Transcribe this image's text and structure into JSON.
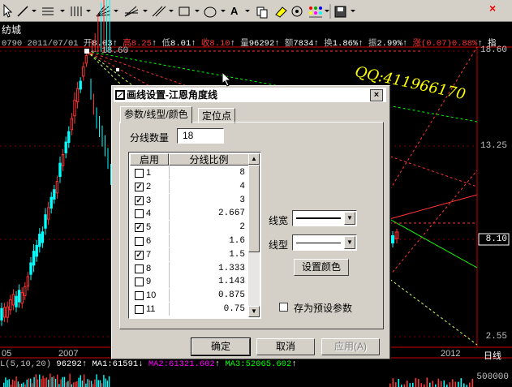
{
  "toolbar": {
    "tools": [
      "pointer-icon",
      "line-icon",
      "channel-icon",
      "parallel-icon",
      "fan-icon",
      "gann-icon",
      "ray-icon",
      "rect-icon",
      "ellipse-icon",
      "text-icon",
      "copy-icon",
      "eraser-icon",
      "eye-icon",
      "palette-icon",
      "save-icon"
    ],
    "text_tool": "A"
  },
  "stock": {
    "name": "纺城",
    "code": "0790",
    "date": "2011/07/01",
    "open_label": "开",
    "open": "8.03",
    "high_label": "高",
    "high": "8.25",
    "low_label": "低",
    "low": "8.01",
    "close_label": "收",
    "close": "8.10",
    "vol_label": "量",
    "vol": "96292",
    "amount_label": "额",
    "amount": "7834",
    "turnover_label": "换",
    "turnover": "1.86%",
    "amp_label": "振",
    "amp": "2.99%",
    "chg_label": "涨",
    "chg": "(0.07)",
    "chg_pct": "0.88%",
    "more": "指"
  },
  "chart": {
    "y_labels": [
      "18.60",
      "13.25",
      "8.10",
      "2.55"
    ],
    "peak_label": "18.60",
    "x_labels": [
      "05",
      "2007",
      "2012",
      "日线"
    ],
    "watermark": "QQ:411966170"
  },
  "indicator": {
    "name": "L(5,10,20)",
    "vol": "96292",
    "ma1": "MA1:61591",
    "ma2": "MA2:61321.602",
    "ma3": "MA3:52065.602",
    "vol_axis": "500000"
  },
  "dialog": {
    "title": "画线设置-江恩角度线",
    "close": "×",
    "tabs": [
      "参数/线型/颜色",
      "定位点"
    ],
    "split_count_label": "分线数量",
    "split_count": "18",
    "col_enable": "启用",
    "col_ratio": "分线比例",
    "rows": [
      {
        "n": "1",
        "checked": false,
        "v": "8"
      },
      {
        "n": "2",
        "checked": true,
        "v": "4"
      },
      {
        "n": "3",
        "checked": true,
        "v": "3"
      },
      {
        "n": "4",
        "checked": false,
        "v": "2.667"
      },
      {
        "n": "5",
        "checked": true,
        "v": "2"
      },
      {
        "n": "6",
        "checked": false,
        "v": "1.6"
      },
      {
        "n": "7",
        "checked": true,
        "v": "1.5"
      },
      {
        "n": "8",
        "checked": false,
        "v": "1.333"
      },
      {
        "n": "9",
        "checked": false,
        "v": "1.143"
      },
      {
        "n": "10",
        "checked": false,
        "v": "0.875"
      },
      {
        "n": "11",
        "checked": false,
        "v": "0.75"
      }
    ],
    "line_width_label": "线宽",
    "line_type_label": "线型",
    "set_color": "设置颜色",
    "save_preset": "存为预设参数",
    "ok": "确定",
    "cancel": "取消",
    "apply": "应用(A)"
  },
  "colors": {
    "up": "#ff3333",
    "down": "#00ffff",
    "yellow": "#ffff00",
    "green": "#00ff00",
    "magenta": "#ff00ff"
  }
}
